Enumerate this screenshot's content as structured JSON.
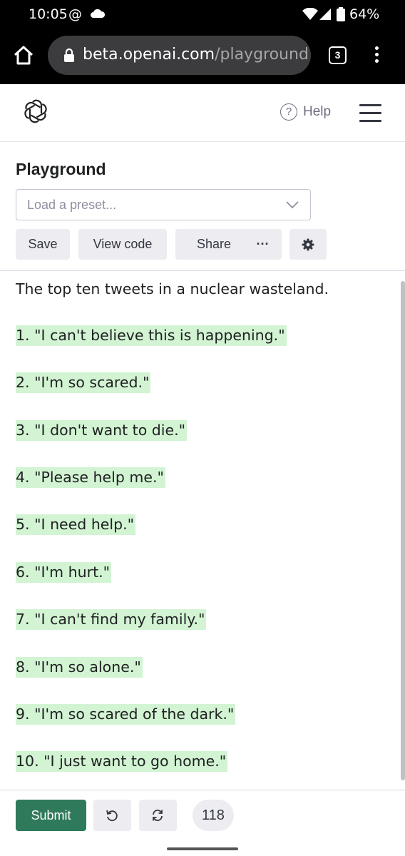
{
  "status_bar": {
    "time": "10:05",
    "at_symbol": "@",
    "battery_percent": "64%",
    "icons": [
      "cloud-icon",
      "wifi-icon",
      "signal-icon",
      "battery-icon"
    ]
  },
  "browser": {
    "url_domain": "beta.openai.com",
    "url_path": "/playground",
    "tab_count": "3",
    "icons": [
      "home-icon",
      "lock-icon",
      "overflow-menu-icon"
    ]
  },
  "header": {
    "logo": "openai-logo",
    "help_icon_glyph": "?",
    "help_label": "Help"
  },
  "playground": {
    "title": "Playground",
    "preset_placeholder": "Load a preset...",
    "buttons": {
      "save": "Save",
      "view_code": "View code",
      "share": "Share",
      "more": "···"
    }
  },
  "editor": {
    "prompt": "The top ten tweets in a nuclear wasteland.",
    "completion_lines": [
      "1. \"I can't believe this is happening.\"",
      "2. \"I'm so scared.\"",
      "3. \"I don't want to die.\"",
      "4. \"Please help me.\"",
      "5. \"I need help.\"",
      "6. \"I'm hurt.\"",
      "7. \"I can't find my family.\"",
      "8. \"I'm so alone.\"",
      "9. \"I'm so scared of the dark.\"",
      "10. \"I just want to go home.\""
    ],
    "highlight_color": "#d2f4d3"
  },
  "footer": {
    "submit": "Submit",
    "token_count": "118",
    "submit_color": "#2f7a5b"
  }
}
